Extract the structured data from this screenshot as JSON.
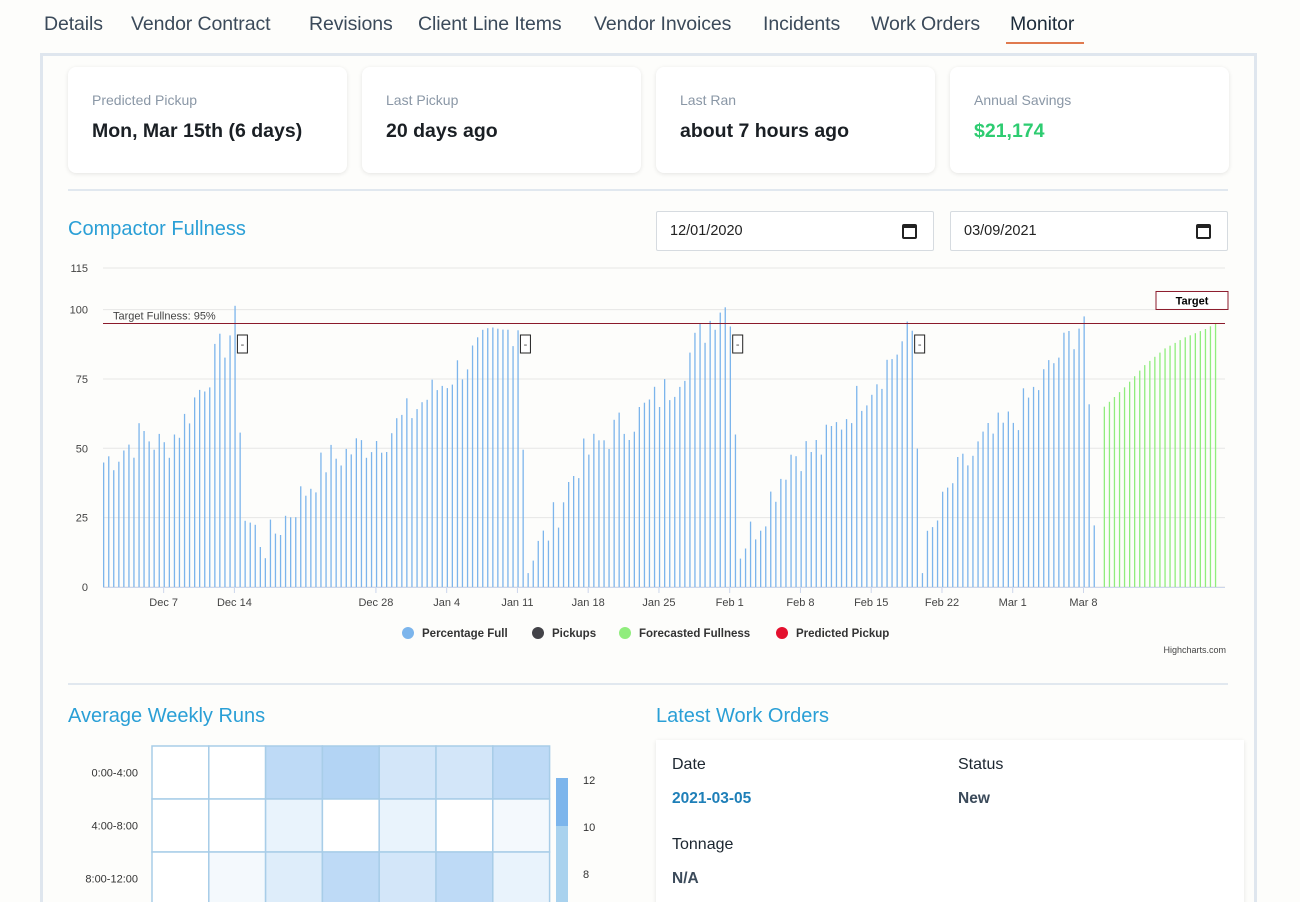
{
  "tabs": [
    {
      "label": "Details",
      "active": false
    },
    {
      "label": "Vendor Contract",
      "active": false
    },
    {
      "label": "Revisions",
      "active": false
    },
    {
      "label": "Client Line Items",
      "active": false
    },
    {
      "label": "Vendor Invoices",
      "active": false
    },
    {
      "label": "Incidents",
      "active": false
    },
    {
      "label": "Work Orders",
      "active": false
    },
    {
      "label": "Monitor",
      "active": true
    }
  ],
  "stats": [
    {
      "label": "Predicted Pickup",
      "value": "Mon, Mar 15th (6 days)"
    },
    {
      "label": "Last Pickup",
      "value": "20 days ago"
    },
    {
      "label": "Last Ran",
      "value": "about 7 hours ago"
    },
    {
      "label": "Annual Savings",
      "value": "$21,174"
    }
  ],
  "colors": {
    "accent": "#2a9fd6",
    "savings": "#2ecc71",
    "tab_underline": "#e07a4f",
    "target_line": "#8b1a2b"
  },
  "compactor": {
    "title": "Compactor Fullness",
    "start_date": "12/01/2020",
    "end_date": "03/09/2021",
    "credits": "Highcharts.com"
  },
  "chart_data": {
    "type": "bar",
    "title": "Compactor Fullness",
    "ylim": [
      0,
      115
    ],
    "yticks": [
      0,
      25,
      50,
      75,
      100,
      115
    ],
    "grid": true,
    "x_range": [
      "2020-12-01",
      "2021-03-21"
    ],
    "xticks": [
      "Dec 7",
      "Dec 14",
      "Dec 28",
      "Jan 4",
      "Jan 11",
      "Jan 18",
      "Jan 25",
      "Feb 1",
      "Feb 8",
      "Feb 15",
      "Feb 22",
      "Mar 1",
      "Mar 8"
    ],
    "target": {
      "value": 95,
      "label": "Target Fullness: 95%",
      "tag": "Target"
    },
    "pickup_marker": "-",
    "pickups": [
      "2020-12-14",
      "2021-01-11",
      "2021-02-01",
      "2021-02-19"
    ],
    "legend": {
      "position": "bottom-center",
      "items": [
        {
          "name": "Percentage Full",
          "color": "#7cb5ec"
        },
        {
          "name": "Pickups",
          "color": "#434348"
        },
        {
          "name": "Forecasted Fullness",
          "color": "#90ed7d"
        },
        {
          "name": "Predicted Pickup",
          "color": "#e4102e"
        }
      ]
    },
    "series": [
      {
        "name": "Percentage Full",
        "color": "#7cb5ec",
        "points": [
          [
            "2020-12-01",
            45
          ],
          [
            "2020-12-03",
            50
          ],
          [
            "2020-12-05",
            55
          ],
          [
            "2020-12-07",
            50
          ],
          [
            "2020-12-09",
            60
          ],
          [
            "2020-12-11",
            75
          ],
          [
            "2020-12-13",
            88
          ],
          [
            "2020-12-14",
            95
          ],
          [
            "2020-12-15",
            25
          ],
          [
            "2020-12-17",
            15
          ],
          [
            "2020-12-20",
            30
          ],
          [
            "2020-12-23",
            45
          ],
          [
            "2020-12-26",
            50
          ],
          [
            "2020-12-29",
            55
          ],
          [
            "2021-01-01",
            65
          ],
          [
            "2021-01-04",
            75
          ],
          [
            "2021-01-07",
            85
          ],
          [
            "2021-01-10",
            92
          ],
          [
            "2021-01-11",
            95
          ],
          [
            "2021-01-12",
            8
          ],
          [
            "2021-01-14",
            20
          ],
          [
            "2021-01-17",
            45
          ],
          [
            "2021-01-20",
            55
          ],
          [
            "2021-01-23",
            62
          ],
          [
            "2021-01-26",
            72
          ],
          [
            "2021-01-29",
            90
          ],
          [
            "2021-01-31",
            102
          ],
          [
            "2021-02-01",
            100
          ],
          [
            "2021-02-02",
            14
          ],
          [
            "2021-02-04",
            25
          ],
          [
            "2021-02-07",
            48
          ],
          [
            "2021-02-10",
            50
          ],
          [
            "2021-02-13",
            65
          ],
          [
            "2021-02-16",
            78
          ],
          [
            "2021-02-18",
            88
          ],
          [
            "2021-02-19",
            92
          ],
          [
            "2021-02-20",
            10
          ],
          [
            "2021-02-23",
            38
          ],
          [
            "2021-02-26",
            52
          ],
          [
            "2021-03-01",
            60
          ],
          [
            "2021-03-04",
            75
          ],
          [
            "2021-03-07",
            92
          ],
          [
            "2021-03-08",
            98
          ],
          [
            "2021-03-09",
            20
          ]
        ]
      },
      {
        "name": "Forecasted Fullness",
        "color": "#90ed7d",
        "points": [
          [
            "2021-03-10",
            65
          ],
          [
            "2021-03-12",
            72
          ],
          [
            "2021-03-14",
            80
          ],
          [
            "2021-03-16",
            86
          ],
          [
            "2021-03-18",
            90
          ],
          [
            "2021-03-20",
            93
          ],
          [
            "2021-03-21",
            95
          ]
        ]
      }
    ]
  },
  "weekly_runs": {
    "title": "Average Weekly Runs",
    "rows": [
      "0:00-4:00",
      "4:00-8:00",
      "8:00-12:00"
    ],
    "values": [
      [
        0,
        0,
        6,
        7,
        4,
        4,
        6
      ],
      [
        0,
        0,
        2,
        0,
        2,
        0,
        1
      ],
      [
        0,
        1,
        3,
        6,
        4,
        6,
        2
      ]
    ],
    "scale_ticks": [
      12,
      10,
      8
    ],
    "scale_max": 12
  },
  "work_orders": {
    "title": "Latest Work Orders",
    "date_label": "Date",
    "date_value": "2021-03-05",
    "status_label": "Status",
    "status_value": "New",
    "tonnage_label": "Tonnage",
    "tonnage_value": "N/A"
  }
}
